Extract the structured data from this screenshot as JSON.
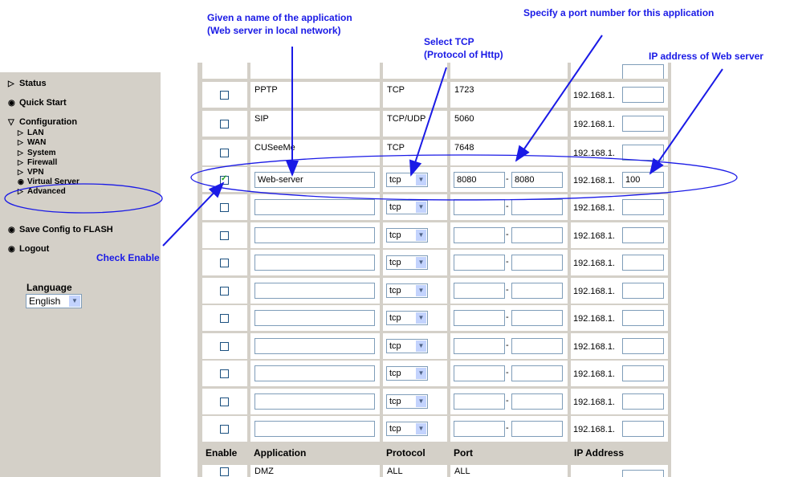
{
  "sidebar": {
    "items": [
      {
        "icon": "triangle-right-icon",
        "label": "Status"
      },
      {
        "icon": "circle-bullet-icon",
        "label": "Quick Start"
      },
      {
        "icon": "triangle-down-icon",
        "label": "Configuration"
      }
    ],
    "config_children": [
      {
        "label": "LAN"
      },
      {
        "label": "WAN"
      },
      {
        "label": "System"
      },
      {
        "label": "Firewall"
      },
      {
        "label": "VPN"
      },
      {
        "label": "Virtual Server"
      },
      {
        "label": "Advanced"
      }
    ],
    "bottom_items": [
      {
        "icon": "circle-bullet-icon",
        "label": "Save Config to FLASH"
      },
      {
        "icon": "circle-bullet-icon",
        "label": "Logout"
      }
    ],
    "language_label": "Language",
    "language_value": "English"
  },
  "table": {
    "ip_prefix": "192.168.1.",
    "preset_rows": [
      {
        "application": "PPTP",
        "protocol": "TCP",
        "port": "1723"
      },
      {
        "application": "SIP",
        "protocol": "TCP/UDP",
        "port": "5060"
      },
      {
        "application": "CUSeeMe",
        "protocol": "TCP",
        "port": "7648"
      }
    ],
    "edited_row": {
      "enabled": true,
      "application": "Web-server",
      "protocol": "tcp",
      "port_start": "8080",
      "port_end": "8080",
      "ip_last": "100"
    },
    "blank_rows_protocol": "tcp",
    "blank_row_count": 9,
    "headers": {
      "enable": "Enable",
      "application": "Application",
      "protocol": "Protocol",
      "port": "Port",
      "ip": "IP Address"
    },
    "dmz_row": {
      "application": "DMZ",
      "protocol": "ALL",
      "port": "ALL"
    }
  },
  "annotations": {
    "app_name": [
      "Given a name of the application",
      "(Web server in local network)"
    ],
    "protocol": [
      "Select TCP",
      "(Protocol of Http)"
    ],
    "port": "Specify a port number for this application",
    "ip": "IP address of Web server",
    "enable": "Check Enable",
    "color": "#1a1ae6"
  }
}
